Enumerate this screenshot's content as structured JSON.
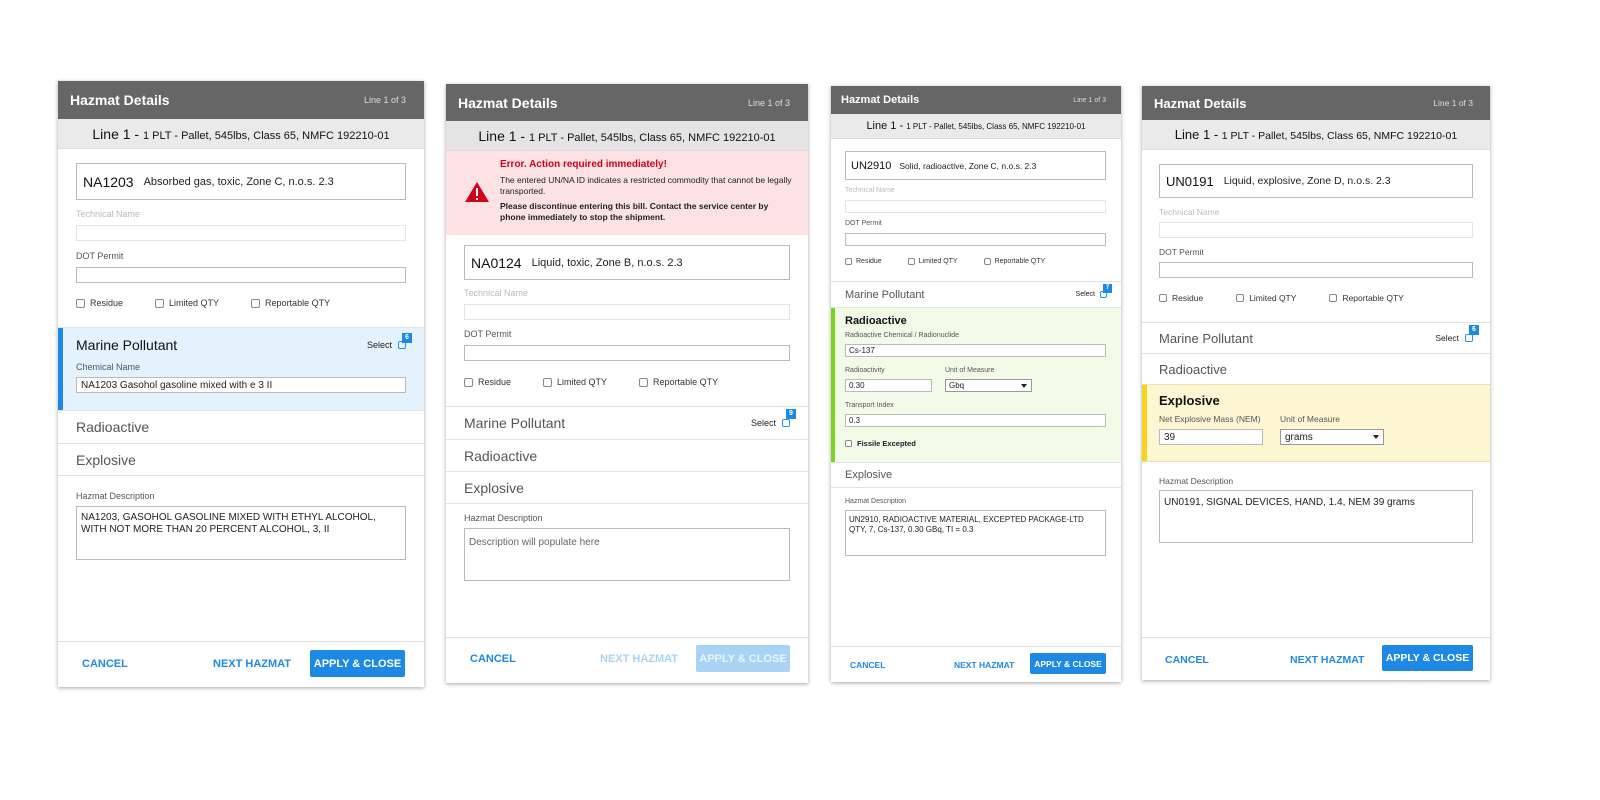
{
  "common": {
    "panel_title": "Hazmat Details",
    "line_count": "Line 1 of 3",
    "line_label": "Line 1 -",
    "line_sub": "1 PLT - Pallet, 545lbs, Class 65, NMFC 192210-01",
    "technical_name": "Technical Name",
    "dot_permit": "DOT Permit",
    "residue": "Residue",
    "limited_qty": "Limited QTY",
    "reportable_qty": "Reportable QTY",
    "marine_pollutant": "Marine Pollutant",
    "radioactive": "Radioactive",
    "explosive": "Explosive",
    "select": "Select",
    "hazmat_description": "Hazmat Description",
    "cancel": "CANCEL",
    "next_hazmat": "NEXT HAZMAT",
    "apply_close": "APPLY & CLOSE"
  },
  "panel1": {
    "un_code": "NA1203",
    "un_desc": "Absorbed gas, toxic, Zone C, n.o.s. 2.3",
    "badge": "6",
    "chemical_name_label": "Chemical Name",
    "chemical_name_value": "NA1203 Gasohol gasoline mixed with e 3 II",
    "description": "NA1203, GASOHOL GASOLINE MIXED WITH ETHYL ALCOHOL, WITH NOT MORE THAN 20 PERCENT ALCOHOL, 3, II",
    "accent": "#1e88e5",
    "section_bg": "#e3f2fd"
  },
  "panel2": {
    "error_title": "Error. Action required immediately!",
    "error_msg": "The entered UN/NA ID indicates a restricted commodity that cannot be legally transported.",
    "error_msg_bold": "Please discontinue entering this bill. Contact the service center by phone immediately to stop the shipment.",
    "un_code": "NA0124",
    "un_desc": "Liquid, toxic, Zone B, n.o.s. 2.3",
    "badge": "9",
    "description_placeholder": "Description will populate here",
    "warning_color": "#d0021b"
  },
  "panel3": {
    "un_code": "UN2910",
    "un_desc": "Solid, radioactive, Zone C, n.o.s. 2.3",
    "badge": "7",
    "section_title": "Radioactive",
    "chem_label": "Radioactive Chemical / Radionuclide",
    "chem_value": "Cs-137",
    "activity_label": "Radioactivity",
    "activity_value": "0.30",
    "uom_label": "Unit of Measure",
    "uom_value": "Gbq",
    "transport_label": "Transport Index",
    "transport_value": "0.3",
    "fissile": "Fissile Excepted",
    "description": "UN2910, RADIOACTIVE MATERIAL, EXCEPTED PACKAGE-LTD QTY, 7, Cs-137, 0.30 GBq, TI = 0.3",
    "accent": "#7ed321",
    "section_bg": "#f1fbe8"
  },
  "panel4": {
    "un_code": "UN0191",
    "un_desc": "Liquid, explosive, Zone D, n.o.s. 2.3",
    "badge": "6",
    "section_title": "Explosive",
    "nem_label": "Net Explosive Mass (NEM)",
    "nem_value": "39",
    "uom_label": "Unit of Measure",
    "uom_value": "grams",
    "description": "UN0191, SIGNAL DEVICES, HAND, 1.4, NEM 39 grams",
    "accent": "#f8d21c",
    "section_bg": "#fdf6d3"
  }
}
